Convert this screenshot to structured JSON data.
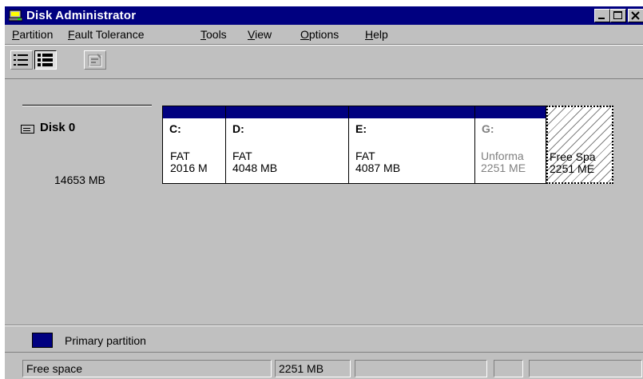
{
  "window": {
    "title": "Disk Administrator"
  },
  "menu": [
    {
      "label_pre": "",
      "label_u": "P",
      "label_post": "artition"
    },
    {
      "label_pre": "",
      "label_u": "F",
      "label_post": "ault Tolerance"
    },
    {
      "label_pre": "",
      "label_u": "T",
      "label_post": "ools"
    },
    {
      "label_pre": "",
      "label_u": "V",
      "label_post": "iew"
    },
    {
      "label_pre": "",
      "label_u": "O",
      "label_post": "ptions"
    },
    {
      "label_pre": "",
      "label_u": "H",
      "label_post": "elp"
    }
  ],
  "toolbar": {
    "buttons": [
      {
        "icon": "volumes-view-icon",
        "state": "raised"
      },
      {
        "icon": "disk-configuration-view-icon",
        "state": "pressed"
      },
      {
        "icon": "properties-icon",
        "state": "disabled"
      }
    ]
  },
  "disk": {
    "label": "Disk 0",
    "size": "14653 MB"
  },
  "partitions": [
    {
      "letter": "C:",
      "fs": "FAT",
      "size": "2016 M",
      "type": "primary"
    },
    {
      "letter": "D:",
      "fs": "FAT",
      "size": "4048 MB",
      "type": "primary"
    },
    {
      "letter": "E:",
      "fs": "FAT",
      "size": "4087 MB",
      "type": "primary"
    },
    {
      "letter": "G:",
      "fs": "Unforma",
      "size": "2251 ME",
      "type": "primary-unformatted"
    },
    {
      "letter": "",
      "fs": "Free Spa",
      "size": "2251 ME",
      "type": "free",
      "selected": true
    }
  ],
  "legend": {
    "label": "Primary partition",
    "color": "#000080"
  },
  "status": {
    "description": "Free space",
    "size": "2251 MB",
    "col3": "",
    "col4": "",
    "col5": ""
  },
  "colors": {
    "titlebar": "#000080",
    "face": "#c0c0c0",
    "primary": "#000080"
  }
}
